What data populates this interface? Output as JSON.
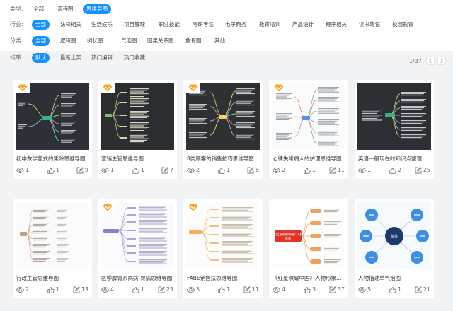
{
  "filters": {
    "type": {
      "label": "类型:",
      "options": [
        "全部",
        "流程图",
        "思维导图"
      ],
      "selected": "思维导图"
    },
    "industry": {
      "label": "行业:",
      "options": [
        "全部",
        "法律相关",
        "生活娱乐",
        "项目管理",
        "职业技能",
        "考研考证",
        "电子商务",
        "教育培训",
        "产品设计",
        "程序相关",
        "读书笔记",
        "校园教育"
      ],
      "selected": "全部"
    },
    "category": {
      "label": "分类:",
      "options": [
        "全部",
        "逻辑图",
        "树状图",
        "气泡图",
        "因果关系图",
        "鱼骨图",
        "其他"
      ],
      "selected": "全部"
    },
    "sort": {
      "label": "排序:",
      "options": [
        "默认",
        "最新上架",
        "热门编辑",
        "热门收藏"
      ],
      "selected": "默认"
    }
  },
  "pagination": {
    "text": "1/37",
    "prev_icon": "chevron-left-icon",
    "next_icon": "chevron-right-icon"
  },
  "colors": {
    "accent": "#1890ff",
    "badge": "#f5a623",
    "text": "#333333",
    "muted": "#666666"
  },
  "cards": [
    {
      "title": "初中数学整式的乘除思维导图",
      "views": "1",
      "likes": "1",
      "edits": "9",
      "premium": true,
      "style": "dark-mind"
    },
    {
      "title": "营销主管思维导图",
      "views": "1",
      "likes": "1",
      "edits": "7",
      "premium": true,
      "style": "dark-tree"
    },
    {
      "title": "8类顾客的销售技巧思维导图",
      "views": "2",
      "likes": "1",
      "edits": "8",
      "premium": true,
      "style": "dark-mind-wide"
    },
    {
      "title": "心律失常病人的护理思维导图",
      "views": "2",
      "likes": "1",
      "edits": "11",
      "premium": true,
      "style": "light-mind"
    },
    {
      "title": "英语一般现在时知识点整理思维导图",
      "views": "1",
      "likes": "2",
      "edits": "25",
      "premium": false,
      "style": "dark-mind-right"
    },
    {
      "title": "行政主管思维导图",
      "views": "2",
      "likes": "1",
      "edits": "13",
      "premium": false,
      "style": "light-tree"
    },
    {
      "title": "医学脾胃系病病-胃痛思维导图",
      "views": "4",
      "likes": "1",
      "edits": "23",
      "premium": true,
      "style": "light-purple"
    },
    {
      "title": "FABE销售法思维导图",
      "views": "5",
      "likes": "1",
      "edits": "11",
      "premium": true,
      "style": "light-orange"
    },
    {
      "title": "《红星照耀中国》人物形象思维导图",
      "views": "4",
      "likes": "3",
      "edits": "37",
      "premium": false,
      "style": "red-orange",
      "thumb_text": "《红星照耀中国》人物 形象"
    },
    {
      "title": "人物描述单气泡图",
      "views": "5",
      "likes": "1",
      "edits": "21",
      "premium": false,
      "style": "bubble",
      "thumb_text": "苗苗"
    }
  ]
}
